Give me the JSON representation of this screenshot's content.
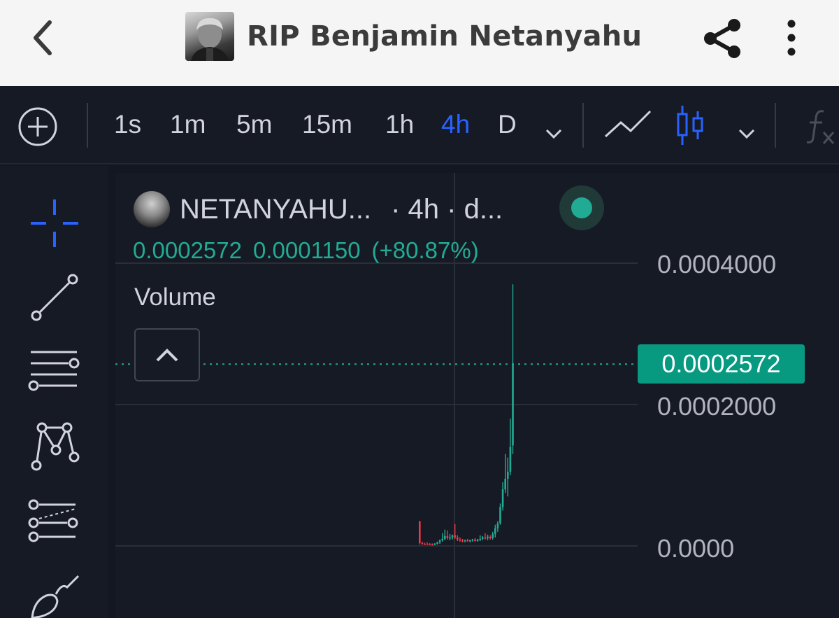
{
  "header": {
    "title": "RIP Benjamin Netanyahu"
  },
  "toolbar": {
    "intervals": [
      "1s",
      "1m",
      "5m",
      "15m",
      "1h",
      "4h",
      "D"
    ],
    "active_interval": "4h",
    "fx_label": "f"
  },
  "legend": {
    "symbol": "NETANYAHU...",
    "meta": "· 4h · d...",
    "last_price": "0.0002572",
    "change": "0.0001150",
    "change_pct": "(+80.87%)",
    "volume_label": "Volume",
    "status": "market-open"
  },
  "price_axis": {
    "labels": [
      "0.0004000",
      "0.0002000",
      "0.0000"
    ],
    "current": "0.0002572"
  },
  "colors": {
    "up": "#22ab94",
    "down": "#f23645",
    "accent": "#2962ff",
    "price_badge": "#089981"
  },
  "chart_data": {
    "type": "candlestick",
    "interval": "4h",
    "ylim": [
      0,
      0.0004
    ],
    "y_ticks": [
      0,
      0.0002,
      0.0004
    ],
    "last": 0.0002572,
    "candles": [
      {
        "o": 3.5e-05,
        "h": 3.5e-05,
        "l": 2e-06,
        "c": 4e-06,
        "dir": "down"
      },
      {
        "o": 4e-06,
        "h": 6e-06,
        "l": 2e-06,
        "c": 3e-06,
        "dir": "down"
      },
      {
        "o": 3e-06,
        "h": 4.5e-06,
        "l": 2e-06,
        "c": 3e-06,
        "dir": "down"
      },
      {
        "o": 3e-06,
        "h": 5e-06,
        "l": 1.5e-06,
        "c": 2.5e-06,
        "dir": "down"
      },
      {
        "o": 2.5e-06,
        "h": 4e-06,
        "l": 1e-06,
        "c": 2e-06,
        "dir": "down"
      },
      {
        "o": 2e-06,
        "h": 3.5e-06,
        "l": 1e-06,
        "c": 1.5e-06,
        "dir": "down"
      },
      {
        "o": 1.5e-06,
        "h": 4e-06,
        "l": 1e-06,
        "c": 3e-06,
        "dir": "up"
      },
      {
        "o": 3e-06,
        "h": 6e-06,
        "l": 2e-06,
        "c": 5e-06,
        "dir": "up"
      },
      {
        "o": 5e-06,
        "h": 9e-06,
        "l": 3e-06,
        "c": 8e-06,
        "dir": "up"
      },
      {
        "o": 8e-06,
        "h": 1.8e-05,
        "l": 6e-06,
        "c": 1e-05,
        "dir": "up"
      },
      {
        "o": 1e-05,
        "h": 2.3e-05,
        "l": 8e-06,
        "c": 1.4e-05,
        "dir": "up"
      },
      {
        "o": 1.4e-05,
        "h": 2.2e-05,
        "l": 9e-06,
        "c": 1.1e-05,
        "dir": "down"
      },
      {
        "o": 1.1e-05,
        "h": 1.7e-05,
        "l": 8e-06,
        "c": 1.2e-05,
        "dir": "up"
      },
      {
        "o": 1.2e-05,
        "h": 1.6e-05,
        "l": 9e-06,
        "c": 1.5e-05,
        "dir": "up"
      },
      {
        "o": 1.5e-05,
        "h": 3.1e-05,
        "l": 1e-05,
        "c": 1.2e-05,
        "dir": "down"
      },
      {
        "o": 1.2e-05,
        "h": 1.5e-05,
        "l": 7e-06,
        "c": 9e-06,
        "dir": "down"
      },
      {
        "o": 9e-06,
        "h": 1.2e-05,
        "l": 6e-06,
        "c": 8e-06,
        "dir": "down"
      },
      {
        "o": 8e-06,
        "h": 1e-05,
        "l": 5e-06,
        "c": 7e-06,
        "dir": "down"
      },
      {
        "o": 7e-06,
        "h": 9e-06,
        "l": 5e-06,
        "c": 8e-06,
        "dir": "up"
      },
      {
        "o": 8e-06,
        "h": 1e-05,
        "l": 6e-06,
        "c": 7e-06,
        "dir": "down"
      },
      {
        "o": 7e-06,
        "h": 9e-06,
        "l": 5e-06,
        "c": 8e-06,
        "dir": "up"
      },
      {
        "o": 8e-06,
        "h": 1e-05,
        "l": 6e-06,
        "c": 9e-06,
        "dir": "up"
      },
      {
        "o": 9e-06,
        "h": 1.1e-05,
        "l": 6e-06,
        "c": 7e-06,
        "dir": "down"
      },
      {
        "o": 7e-06,
        "h": 1e-05,
        "l": 6e-06,
        "c": 9e-06,
        "dir": "up"
      },
      {
        "o": 9e-06,
        "h": 1.5e-05,
        "l": 7e-06,
        "c": 1e-05,
        "dir": "up"
      },
      {
        "o": 1e-05,
        "h": 1.4e-05,
        "l": 8e-06,
        "c": 1.2e-05,
        "dir": "up"
      },
      {
        "o": 1.2e-05,
        "h": 1.8e-05,
        "l": 9e-06,
        "c": 1.1e-05,
        "dir": "down"
      },
      {
        "o": 1.1e-05,
        "h": 1.6e-05,
        "l": 8e-06,
        "c": 1.3e-05,
        "dir": "up"
      },
      {
        "o": 1.3e-05,
        "h": 1.5e-05,
        "l": 9e-06,
        "c": 1.1e-05,
        "dir": "down"
      },
      {
        "o": 1.1e-05,
        "h": 2e-05,
        "l": 9e-06,
        "c": 1.7e-05,
        "dir": "up"
      },
      {
        "o": 1.7e-05,
        "h": 3e-05,
        "l": 1.2e-05,
        "c": 2.5e-05,
        "dir": "up"
      },
      {
        "o": 2.5e-05,
        "h": 3.5e-05,
        "l": 2e-05,
        "c": 3.2e-05,
        "dir": "up"
      },
      {
        "o": 3.2e-05,
        "h": 6e-05,
        "l": 3e-05,
        "c": 5.5e-05,
        "dir": "up"
      },
      {
        "o": 5.5e-05,
        "h": 9e-05,
        "l": 5e-05,
        "c": 8e-05,
        "dir": "up"
      },
      {
        "o": 8e-05,
        "h": 0.00013,
        "l": 7.5e-05,
        "c": 9.5e-05,
        "dir": "up"
      },
      {
        "o": 9.5e-05,
        "h": 0.000125,
        "l": 7e-05,
        "c": 0.000105,
        "dir": "up"
      },
      {
        "o": 0.000105,
        "h": 0.00018,
        "l": 0.0001,
        "c": 0.00014,
        "dir": "up"
      },
      {
        "o": 0.0001422,
        "h": 0.00037,
        "l": 0.00013,
        "c": 0.0002572,
        "dir": "up"
      }
    ]
  }
}
